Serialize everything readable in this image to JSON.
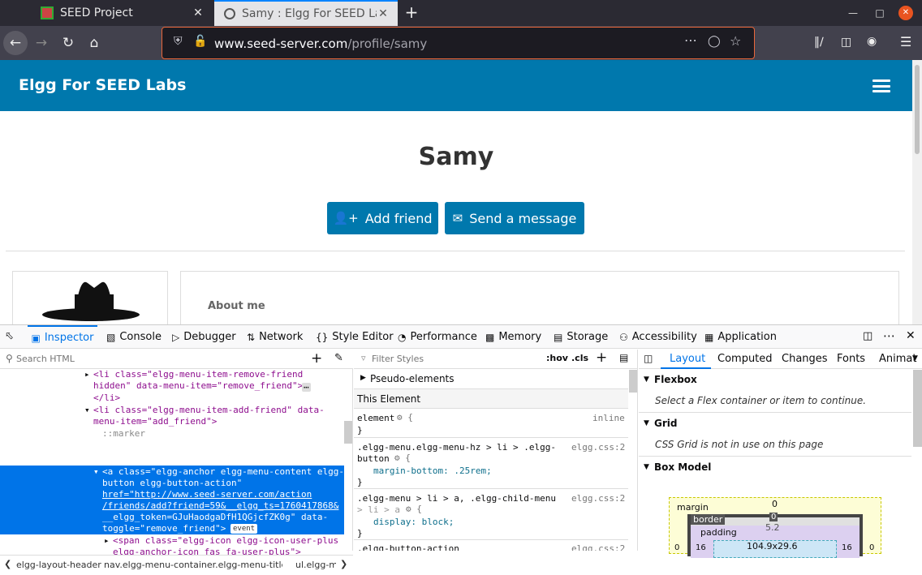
{
  "browser": {
    "tabs": [
      {
        "title": "SEED Project",
        "close": "✕"
      },
      {
        "title": "Samy : Elgg For SEED Labs",
        "close": "✕"
      }
    ],
    "new_tab": "+",
    "url": {
      "host": "www.seed-server.com",
      "path": "/profile/samy"
    }
  },
  "page": {
    "site_title": "Elgg For SEED Labs",
    "profile_name": "Samy",
    "add_friend": "Add friend",
    "send_message": "Send a message",
    "about_me": "About me"
  },
  "devtools": {
    "tabs": [
      "Inspector",
      "Console",
      "Debugger",
      "Network",
      "Style Editor",
      "Performance",
      "Memory",
      "Storage",
      "Accessibility",
      "Application"
    ],
    "search_placeholder": "Search HTML",
    "filter_placeholder": "Filter Styles",
    "hov": ":hov",
    "cls": ".cls",
    "breadcrumbs": [
      "elgg-layout-header",
      "nav.elgg-menu-container.elgg-menu-title-...",
      "ul.elgg-m"
    ],
    "markup": {
      "l1a": "<li class=\"elgg-menu-item-remove-friend",
      "l1b": "hidden\" data-menu-item=\"remove_friend\">",
      "l1c": "</li>",
      "l2a": "<li class=\"elgg-menu-item-add-friend\" data-",
      "l2b": "menu-item=\"add_friend\">",
      "marker": "::marker",
      "s1": "<a class=\"elgg-anchor elgg-menu-content elgg-",
      "s2": "button elgg-button-action\"",
      "s3": "href=\"http://www.seed-server.com/action",
      "s4": "/friends/add?friend=59&__elgg_ts=1760417868&",
      "s5": "__elgg_token=GJuHaodgaDfH1QGjcfZK0g\" data-",
      "s6": "toggle=\"remove_friend\">",
      "event": "event",
      "last1": "<span class=\"elgg-icon elgg-icon-user-plus",
      "last2": "elgg-anchor-icon fas fa-user-plus\">"
    },
    "rules": {
      "pseudo": "Pseudo-elements",
      "this_element": "This Element",
      "r1_sel": "element",
      "r1_src": "inline",
      "r2_sel1": ".elgg-menu.elgg-menu-hz > li > .elgg-",
      "r2_sel2": "button",
      "r2_src": "elgg.css:2",
      "r2_prop": "margin-bottom: .25rem;",
      "r3_sel1": ".elgg-menu > li > a, .elgg-child-menu",
      "r3_sel2": "> li > a",
      "r3_src": "elgg.css:2",
      "r3_prop": "display: block;",
      "r4_sel": ".elgg-button-action",
      "r4_src": "elgg.css:2"
    },
    "layout": {
      "tabs": [
        "Layout",
        "Computed",
        "Changes",
        "Fonts",
        "Animat"
      ],
      "flexbox": "Flexbox",
      "flex_msg": "Select a Flex container or item to continue.",
      "grid": "Grid",
      "grid_msg": "CSS Grid is not in use on this page",
      "boxmodel": "Box Model",
      "margin": "margin",
      "border": "border",
      "padding": "padding",
      "m_val": "0",
      "b_val": "0",
      "p_val": "5.2",
      "side_l": "0",
      "side_b": "0",
      "pad_l": "16",
      "pad_r": "16",
      "side_r_b": "0",
      "side_r_m": "0",
      "content": "104.9x29.6"
    }
  }
}
